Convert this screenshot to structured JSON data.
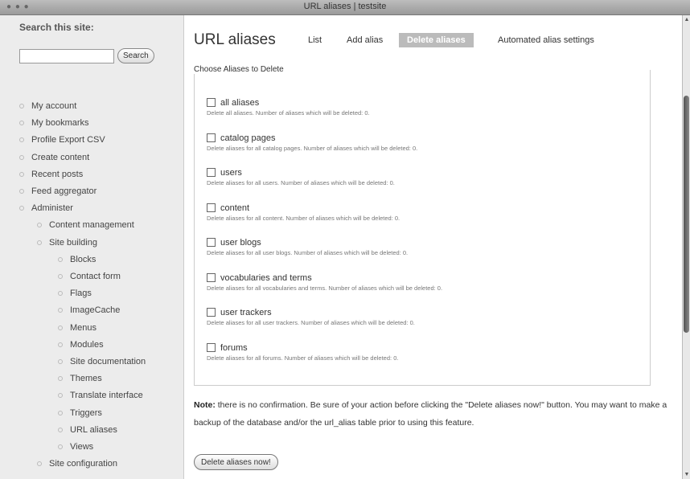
{
  "window": {
    "title": "URL aliases | testsite"
  },
  "search": {
    "label": "Search this site:",
    "value": "",
    "button": "Search"
  },
  "nav": [
    {
      "label": "My account",
      "level": 0
    },
    {
      "label": "My bookmarks",
      "level": 0
    },
    {
      "label": "Profile Export CSV",
      "level": 0
    },
    {
      "label": "Create content",
      "level": 0
    },
    {
      "label": "Recent posts",
      "level": 0
    },
    {
      "label": "Feed aggregator",
      "level": 0
    },
    {
      "label": "Administer",
      "level": 0
    },
    {
      "label": "Content management",
      "level": 1
    },
    {
      "label": "Site building",
      "level": 1
    },
    {
      "label": "Blocks",
      "level": 2
    },
    {
      "label": "Contact form",
      "level": 2
    },
    {
      "label": "Flags",
      "level": 2
    },
    {
      "label": "ImageCache",
      "level": 2
    },
    {
      "label": "Menus",
      "level": 2
    },
    {
      "label": "Modules",
      "level": 2
    },
    {
      "label": "Site documentation",
      "level": 2
    },
    {
      "label": "Themes",
      "level": 2
    },
    {
      "label": "Translate interface",
      "level": 2
    },
    {
      "label": "Triggers",
      "level": 2
    },
    {
      "label": "URL aliases",
      "level": 2
    },
    {
      "label": "Views",
      "level": 2
    },
    {
      "label": "Site configuration",
      "level": 1
    }
  ],
  "page": {
    "title": "URL aliases",
    "tabs": [
      {
        "label": "List",
        "active": false
      },
      {
        "label": "Add alias",
        "active": false
      },
      {
        "label": "Delete aliases",
        "active": true
      },
      {
        "label": "Automated alias settings",
        "active": false
      }
    ],
    "fieldset_legend": "Choose Aliases to Delete",
    "options": [
      {
        "label": "all aliases",
        "desc": "Delete all aliases. Number of aliases which will be deleted: 0."
      },
      {
        "label": "catalog pages",
        "desc": "Delete aliases for all catalog pages. Number of aliases which will be deleted: 0."
      },
      {
        "label": "users",
        "desc": "Delete aliases for all users. Number of aliases which will be deleted: 0."
      },
      {
        "label": "content",
        "desc": "Delete aliases for all content. Number of aliases which will be deleted: 0."
      },
      {
        "label": "user blogs",
        "desc": "Delete aliases for all user blogs. Number of aliases which will be deleted: 0."
      },
      {
        "label": "vocabularies and terms",
        "desc": "Delete aliases for all vocabularies and terms. Number of aliases which will be deleted: 0."
      },
      {
        "label": "user trackers",
        "desc": "Delete aliases for all user trackers. Number of aliases which will be deleted: 0."
      },
      {
        "label": "forums",
        "desc": "Delete aliases for all forums. Number of aliases which will be deleted: 0."
      }
    ],
    "note_label": "Note:",
    "note_text": " there is no confirmation. Be sure of your action before clicking the \"Delete aliases now!\" button. You may want to make a backup of the database and/or the url_alias table prior to using this feature.",
    "submit": "Delete aliases now!"
  }
}
